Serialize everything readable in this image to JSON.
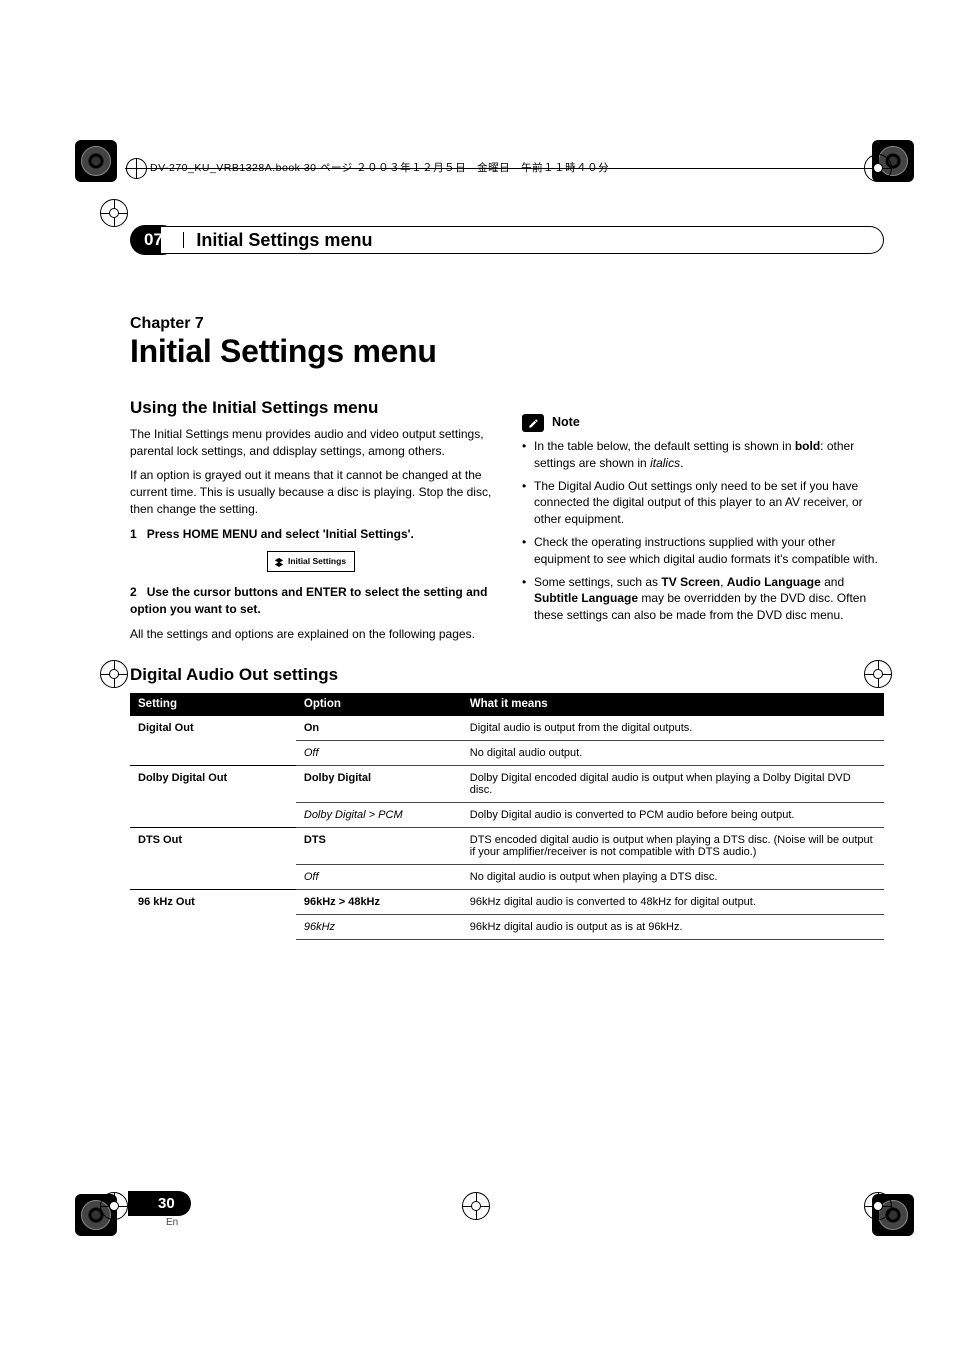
{
  "meta_line": "DV-270_KU_VRB1328A.book  30 ページ  ２００３年１２月５日　金曜日　午前１１時４０分",
  "header": {
    "chapter_num": "07",
    "section_title": "Initial Settings menu"
  },
  "chapter_label": "Chapter 7",
  "main_title": "Initial Settings menu",
  "left": {
    "subhead": "Using the Initial Settings menu",
    "p1": "The Initial Settings menu provides audio and video output settings, parental lock settings, and ddisplay settings, among others.",
    "p2": "If an option is grayed out it means that it cannot be changed at the current time. This is usually because a disc is playing. Stop the disc, then change the setting.",
    "step1_num": "1",
    "step1_text": "Press HOME MENU and select 'Initial Settings'.",
    "chip_text": "Initial Settings",
    "step2_num": "2",
    "step2_text": "Use the cursor buttons and ENTER to select the setting and option you want to set.",
    "p3": "All the settings and options are explained on the following pages."
  },
  "right": {
    "note_label": "Note",
    "bullets": [
      {
        "pre": "In the table below, the default setting is shown in ",
        "bold": "bold",
        "mid": ": other settings are shown in ",
        "ital": "italics",
        "post": "."
      },
      {
        "text": "The Digital Audio Out settings only need to be set if you have connected the digital output of this player to an AV receiver, or other equipment."
      },
      {
        "text": "Check the operating instructions supplied with your other equipment to see which digital audio formats it's compatible with."
      },
      {
        "pre": "Some settings, such as ",
        "b1": "TV Screen",
        "mid1": ", ",
        "b2": "Audio Language",
        "mid2": " and ",
        "b3": "Subtitle Language",
        "post": " may be overridden by the DVD disc. Often these settings can also be made from the DVD disc menu."
      }
    ]
  },
  "table_head": "Digital Audio Out settings",
  "table": {
    "headers": [
      "Setting",
      "Option",
      "What it means"
    ],
    "groups": [
      {
        "setting": "Digital Out",
        "rows": [
          {
            "option": "On",
            "option_style": "bold",
            "meaning": "Digital audio is output from the digital outputs."
          },
          {
            "option": "Off",
            "option_style": "italic",
            "meaning": "No digital audio output."
          }
        ]
      },
      {
        "setting": "Dolby Digital Out",
        "rows": [
          {
            "option": "Dolby Digital",
            "option_style": "bold",
            "meaning": "Dolby Digital encoded digital audio is output when playing a Dolby Digital DVD disc."
          },
          {
            "option": "Dolby Digital > PCM",
            "option_style": "italic",
            "meaning": "Dolby Digital audio is converted to PCM audio before being output."
          }
        ]
      },
      {
        "setting": "DTS Out",
        "rows": [
          {
            "option": "DTS",
            "option_style": "bold",
            "meaning": "DTS encoded digital audio is output when playing a DTS disc. (Noise will be output if your amplifier/receiver is not compatible with DTS audio.)"
          },
          {
            "option": "Off",
            "option_style": "italic",
            "meaning": "No digital audio is output when playing a DTS disc."
          }
        ]
      },
      {
        "setting": "96 kHz Out",
        "rows": [
          {
            "option": "96kHz > 48kHz",
            "option_style": "bold",
            "meaning": "96kHz digital audio is converted to 48kHz for digital output."
          },
          {
            "option": "96kHz",
            "option_style": "italic",
            "meaning": "96kHz digital audio is output as is at 96kHz."
          }
        ]
      }
    ]
  },
  "page_number": "30",
  "page_lang": "En"
}
